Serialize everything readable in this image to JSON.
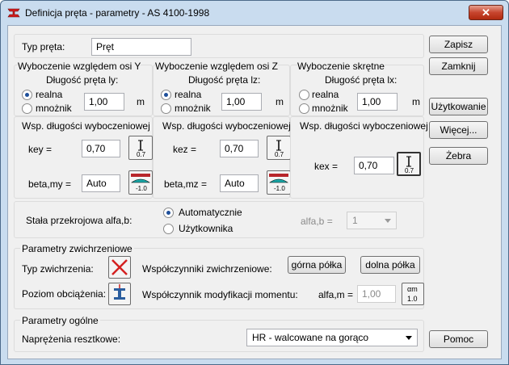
{
  "window": {
    "title": "Definicja pręta - parametry - AS 4100-1998"
  },
  "bar_type": {
    "label": "Typ pręta:",
    "value": "Pręt"
  },
  "buckling_y": {
    "heading": "Wyboczenie względem osi Y",
    "length_label": "Długość pręta ly:",
    "opt_real": "realna",
    "opt_mult": "mnożnik",
    "value": "1,00",
    "unit": "m",
    "coef_heading": "Wsp. długości wyboczeniowej",
    "key_label": "key =",
    "key_value": "0,70",
    "key_icon_text": "0.7",
    "beta_label": "beta,my =",
    "beta_value": "Auto",
    "beta_icon_text": "-1.0"
  },
  "buckling_z": {
    "heading": "Wyboczenie względem osi Z",
    "length_label": "Długość pręta lz:",
    "opt_real": "realna",
    "opt_mult": "mnożnik",
    "value": "1,00",
    "unit": "m",
    "coef_heading": "Wsp. długości wyboczeniowej",
    "key_label": "kez =",
    "key_value": "0,70",
    "key_icon_text": "0.7",
    "beta_label": "beta,mz =",
    "beta_value": "Auto",
    "beta_icon_text": "-1.0"
  },
  "buckling_t": {
    "heading": "Wyboczenie skrętne",
    "length_label": "Długość pręta lx:",
    "opt_real": "realna",
    "opt_mult": "mnożnik",
    "value": "1,00",
    "unit": "m",
    "coef_heading": "Wsp. długości wyboczeniowej",
    "key_label": "kex =",
    "key_value": "0,70",
    "key_icon_text": "0.7"
  },
  "section_const": {
    "label": "Stała przekrojowa alfa,b:",
    "opt_auto": "Automatycznie",
    "opt_user": "Użytkownika",
    "alfa_label": "alfa,b =",
    "alfa_value": "1"
  },
  "ltb": {
    "heading": "Parametry zwichrzeniowe",
    "type_label": "Typ zwichrzenia:",
    "coef_label": "Współczynniki zwichrzeniowe:",
    "top_flange": "górna półka",
    "bottom_flange": "dolna półka",
    "load_level_label": "Poziom obciążenia:",
    "moment_label": "Współczynnik modyfikacji momentu:",
    "alfam_label": "alfa,m =",
    "alfam_value": "1,00",
    "alfam_icon_line1": "αm",
    "alfam_icon_line2": "1.0"
  },
  "general": {
    "heading": "Parametry ogólne",
    "stress_label": "Naprężenia resztkowe:",
    "stress_value": "HR - walcowane na gorąco"
  },
  "buttons": {
    "save": "Zapisz",
    "close": "Zamknij",
    "usage": "Użytkowanie",
    "more": "Więcej...",
    "ribs": "Żebra",
    "help": "Pomoc"
  },
  "colors": {
    "title_bar": "#c9dcef",
    "close_button": "#c7452e",
    "radio_dot": "#1e4f9a",
    "cross_icon": "#d42020"
  }
}
